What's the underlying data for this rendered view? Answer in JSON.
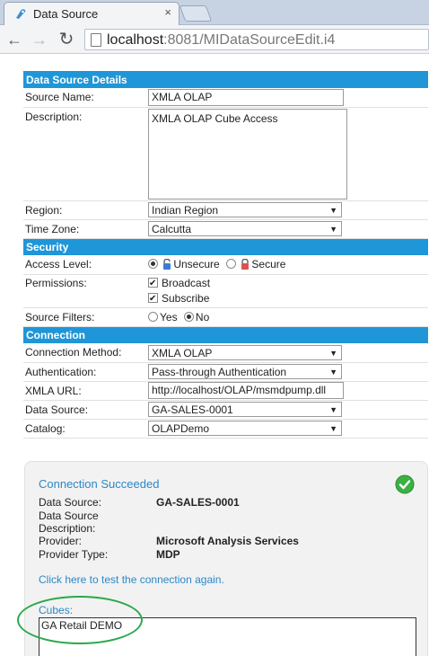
{
  "browser": {
    "tab_title": "Data Source",
    "tab_close": "×",
    "url_host": "localhost",
    "url_rest": ":8081/MIDataSourceEdit.i4",
    "back": "←",
    "forward": "→",
    "reload": "↻"
  },
  "sections": {
    "details": "Data Source Details",
    "security": "Security",
    "connection": "Connection"
  },
  "details": {
    "source_name_label": "Source Name:",
    "source_name_value": "XMLA OLAP",
    "description_label": "Description:",
    "description_value": "XMLA OLAP Cube Access",
    "region_label": "Region:",
    "region_value": "Indian Region",
    "timezone_label": "Time Zone:",
    "timezone_value": "Calcutta"
  },
  "security": {
    "access_level_label": "Access Level:",
    "access_unsecure": "Unsecure",
    "access_secure": "Secure",
    "permissions_label": "Permissions:",
    "perm_broadcast": "Broadcast",
    "perm_subscribe": "Subscribe",
    "source_filters_label": "Source Filters:",
    "filters_yes": "Yes",
    "filters_no": "No"
  },
  "connection": {
    "method_label": "Connection Method:",
    "method_value": "XMLA OLAP",
    "auth_label": "Authentication:",
    "auth_value": "Pass-through Authentication",
    "url_label": "XMLA URL:",
    "url_value": "http://localhost/OLAP/msmdpump.dll",
    "datasource_label": "Data Source:",
    "datasource_value": "GA-SALES-0001",
    "catalog_label": "Catalog:",
    "catalog_value": "OLAPDemo"
  },
  "result": {
    "title": "Connection Succeeded",
    "ds_label": "Data Source:",
    "ds_value": "GA-SALES-0001",
    "desc_label_1": "Data Source",
    "desc_label_2": "Description:",
    "provider_label": "Provider:",
    "provider_value": "Microsoft Analysis Services",
    "ptype_label": "Provider Type:",
    "ptype_value": "MDP",
    "test_link": "Click here to test the connection again.",
    "cubes_label": "Cubes:",
    "cubes": [
      "GA Retail DEMO"
    ]
  },
  "colors": {
    "section_header": "#1f96d8",
    "link": "#2a88c8",
    "success": "#3cb043",
    "highlight": "#2aa84a"
  }
}
